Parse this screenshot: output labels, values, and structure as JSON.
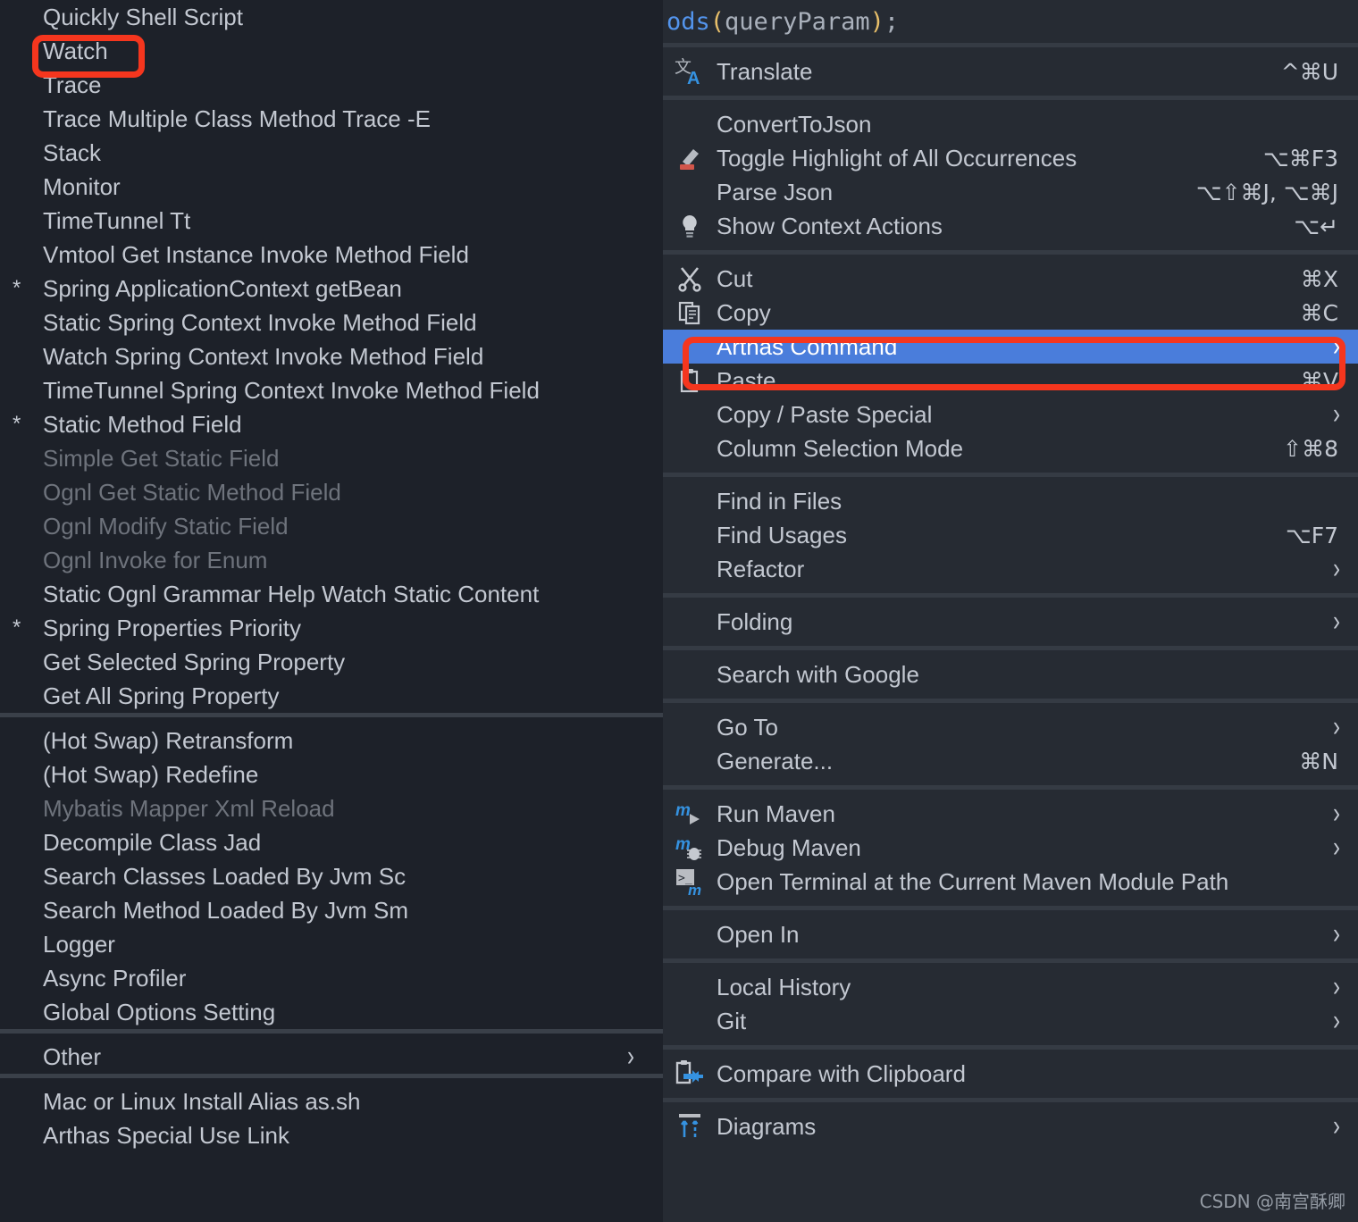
{
  "editor": {
    "code_fragment": [
      {
        "text": "ods",
        "color": "#5394ec"
      },
      {
        "text": "(",
        "color": "#e8bf6a"
      },
      {
        "text": "queryParam",
        "color": "#a9b0bb"
      },
      {
        "text": ")",
        "color": "#e8bf6a"
      },
      {
        "text": ";",
        "color": "#a9b0bb"
      }
    ],
    "code_text": "ods(queryParam);"
  },
  "colors": {
    "menu_bg": "#262b33",
    "submenu_bg": "#1d2129",
    "selection_blue": "#4a7ddb",
    "annotation_red": "#f5361e",
    "text": "#c3c8d1",
    "text_disabled": "#6e737c",
    "separator": "#3a4049"
  },
  "arthas_submenu": {
    "name": "Arthas Command submenu",
    "groups": [
      {
        "items": [
          {
            "label": "Quickly Shell Script",
            "star": false,
            "disabled": false,
            "arrow": false
          },
          {
            "label": "Watch",
            "star": false,
            "disabled": false,
            "arrow": false,
            "annotated": true
          },
          {
            "label": "Trace",
            "star": false,
            "disabled": false,
            "arrow": false
          },
          {
            "label": "Trace Multiple Class Method Trace -E",
            "star": false,
            "disabled": false,
            "arrow": false
          },
          {
            "label": "Stack",
            "star": false,
            "disabled": false,
            "arrow": false
          },
          {
            "label": "Monitor",
            "star": false,
            "disabled": false,
            "arrow": false
          },
          {
            "label": "TimeTunnel Tt",
            "star": false,
            "disabled": false,
            "arrow": false
          },
          {
            "label": "Vmtool Get Instance Invoke Method Field",
            "star": false,
            "disabled": false,
            "arrow": false
          },
          {
            "label": "Spring ApplicationContext getBean",
            "star": true,
            "disabled": false,
            "arrow": false
          },
          {
            "label": "Static Spring Context Invoke  Method Field",
            "star": false,
            "disabled": false,
            "arrow": false
          },
          {
            "label": "Watch Spring Context Invoke Method Field",
            "star": false,
            "disabled": false,
            "arrow": false
          },
          {
            "label": "TimeTunnel Spring Context Invoke Method Field",
            "star": false,
            "disabled": false,
            "arrow": false
          },
          {
            "label": "Static Method Field",
            "star": true,
            "disabled": false,
            "arrow": false
          },
          {
            "label": "Simple Get Static Field",
            "star": false,
            "disabled": true,
            "arrow": false
          },
          {
            "label": "Ognl Get Static Method Field",
            "star": false,
            "disabled": true,
            "arrow": false
          },
          {
            "label": "Ognl Modify Static Field",
            "star": false,
            "disabled": true,
            "arrow": false
          },
          {
            "label": "Ognl Invoke for Enum",
            "star": false,
            "disabled": true,
            "arrow": false
          },
          {
            "label": "Static Ognl Grammar Help Watch Static Content",
            "star": false,
            "disabled": false,
            "arrow": false
          },
          {
            "label": "Spring Properties Priority",
            "star": true,
            "disabled": false,
            "arrow": false
          },
          {
            "label": "Get Selected Spring Property",
            "star": false,
            "disabled": false,
            "arrow": false
          },
          {
            "label": "Get All Spring Property",
            "star": false,
            "disabled": false,
            "arrow": false
          }
        ]
      },
      {
        "items": [
          {
            "label": "(Hot Swap) Retransform",
            "star": false,
            "disabled": false,
            "arrow": false
          },
          {
            "label": "(Hot Swap) Redefine",
            "star": false,
            "disabled": false,
            "arrow": false
          },
          {
            "label": "Mybatis Mapper Xml Reload",
            "star": false,
            "disabled": true,
            "arrow": false
          },
          {
            "label": "Decompile Class Jad",
            "star": false,
            "disabled": false,
            "arrow": false
          },
          {
            "label": "Search Classes Loaded By Jvm Sc",
            "star": false,
            "disabled": false,
            "arrow": false
          },
          {
            "label": "Search Method Loaded By Jvm Sm",
            "star": false,
            "disabled": false,
            "arrow": false
          },
          {
            "label": "Logger",
            "star": false,
            "disabled": false,
            "arrow": false
          },
          {
            "label": "Async Profiler",
            "star": false,
            "disabled": false,
            "arrow": false
          },
          {
            "label": "Global Options Setting",
            "star": false,
            "disabled": false,
            "arrow": false
          }
        ]
      },
      {
        "items": [
          {
            "label": "Other",
            "star": false,
            "disabled": false,
            "arrow": true
          }
        ]
      },
      {
        "items": [
          {
            "label": "Mac or Linux Install Alias as.sh",
            "star": false,
            "disabled": false,
            "arrow": false
          },
          {
            "label": "Arthas Special Use Link",
            "star": false,
            "disabled": false,
            "arrow": false
          }
        ]
      }
    ]
  },
  "context_menu": {
    "name": "Editor context menu",
    "groups": [
      {
        "items": [
          {
            "label": "Translate",
            "icon": "translate-icon",
            "shortcut": "^⌘U",
            "arrow": false,
            "selected": false
          }
        ]
      },
      {
        "items": [
          {
            "label": "ConvertToJson",
            "icon": "",
            "shortcut": "",
            "arrow": false,
            "selected": false
          },
          {
            "label": "Toggle Highlight of All Occurrences",
            "icon": "highlighter-icon",
            "shortcut": "⌥⌘F3",
            "arrow": false,
            "selected": false
          },
          {
            "label": "Parse Json",
            "icon": "",
            "shortcut": "⌥⇧⌘J, ⌥⌘J",
            "arrow": false,
            "selected": false
          },
          {
            "label": "Show Context Actions",
            "icon": "lightbulb-icon",
            "shortcut": "⌥↵",
            "arrow": false,
            "selected": false
          }
        ]
      },
      {
        "items": [
          {
            "label": "Cut",
            "icon": "scissors-icon",
            "shortcut": "⌘X",
            "arrow": false,
            "selected": false
          },
          {
            "label": "Copy",
            "icon": "copy-icon",
            "shortcut": "⌘C",
            "arrow": false,
            "selected": false
          },
          {
            "label": "Arthas Command",
            "icon": "",
            "shortcut": "",
            "arrow": true,
            "selected": true,
            "annotated": true
          },
          {
            "label": "Paste",
            "icon": "paste-icon",
            "shortcut": "⌘V",
            "arrow": false,
            "selected": false
          },
          {
            "label": "Copy / Paste Special",
            "icon": "",
            "shortcut": "",
            "arrow": true,
            "selected": false
          },
          {
            "label": "Column Selection Mode",
            "icon": "",
            "shortcut": "⇧⌘8",
            "arrow": false,
            "selected": false
          }
        ]
      },
      {
        "items": [
          {
            "label": "Find in Files",
            "icon": "",
            "shortcut": "",
            "arrow": false,
            "selected": false
          },
          {
            "label": "Find Usages",
            "icon": "",
            "shortcut": "⌥F7",
            "arrow": false,
            "selected": false
          },
          {
            "label": "Refactor",
            "icon": "",
            "shortcut": "",
            "arrow": true,
            "selected": false
          }
        ]
      },
      {
        "items": [
          {
            "label": "Folding",
            "icon": "",
            "shortcut": "",
            "arrow": true,
            "selected": false
          }
        ]
      },
      {
        "items": [
          {
            "label": "Search with Google",
            "icon": "",
            "shortcut": "",
            "arrow": false,
            "selected": false
          }
        ]
      },
      {
        "items": [
          {
            "label": "Go To",
            "icon": "",
            "shortcut": "",
            "arrow": true,
            "selected": false
          },
          {
            "label": "Generate...",
            "icon": "",
            "shortcut": "⌘N",
            "arrow": false,
            "selected": false
          }
        ]
      },
      {
        "items": [
          {
            "label": "Run Maven",
            "icon": "maven-run-icon",
            "shortcut": "",
            "arrow": true,
            "selected": false
          },
          {
            "label": "Debug Maven",
            "icon": "maven-debug-icon",
            "shortcut": "",
            "arrow": true,
            "selected": false
          },
          {
            "label": "Open Terminal at the Current Maven Module Path",
            "icon": "maven-terminal-icon",
            "shortcut": "",
            "arrow": false,
            "selected": false
          }
        ]
      },
      {
        "items": [
          {
            "label": "Open In",
            "icon": "",
            "shortcut": "",
            "arrow": true,
            "selected": false
          }
        ]
      },
      {
        "items": [
          {
            "label": "Local History",
            "icon": "",
            "shortcut": "",
            "arrow": true,
            "selected": false
          },
          {
            "label": "Git",
            "icon": "",
            "shortcut": "",
            "arrow": true,
            "selected": false
          }
        ]
      },
      {
        "items": [
          {
            "label": "Compare with Clipboard",
            "icon": "compare-clipboard-icon",
            "shortcut": "",
            "arrow": false,
            "selected": false
          }
        ]
      },
      {
        "items": [
          {
            "label": "Diagrams",
            "icon": "diagrams-icon",
            "shortcut": "",
            "arrow": true,
            "selected": false
          }
        ]
      }
    ]
  },
  "watermark": {
    "text": "CSDN @南宫酥卿"
  }
}
